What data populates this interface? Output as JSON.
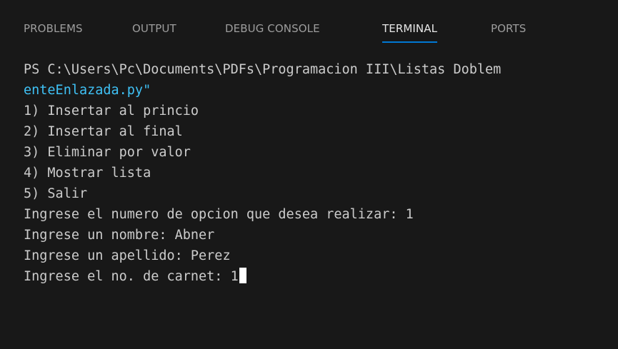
{
  "panel": {
    "tabs": [
      {
        "label": "PROBLEMS",
        "active": false
      },
      {
        "label": "OUTPUT",
        "active": false
      },
      {
        "label": "DEBUG CONSOLE",
        "active": false
      },
      {
        "label": "TERMINAL",
        "active": true
      },
      {
        "label": "PORTS",
        "active": false
      }
    ]
  },
  "terminal": {
    "lines": [
      "PS C:\\Users\\Pc\\Documents\\PDFs\\Programacion III\\Listas Doblem",
      "enteEnlazada.py\"",
      "1) Insertar al princio",
      "2) Insertar al final",
      "3) Eliminar por valor",
      "4) Mostrar lista",
      "5) Salir",
      "Ingrese el numero de opcion que desea realizar: 1",
      "Ingrese un nombre: Abner",
      "Ingrese un apellido: Perez",
      "Ingrese el no. de carnet: 1"
    ]
  },
  "colors": {
    "background": "#181818",
    "active_tab_underline": "#0078d4",
    "path_continuation": "#3fc1f5",
    "text": "#cccccc"
  }
}
